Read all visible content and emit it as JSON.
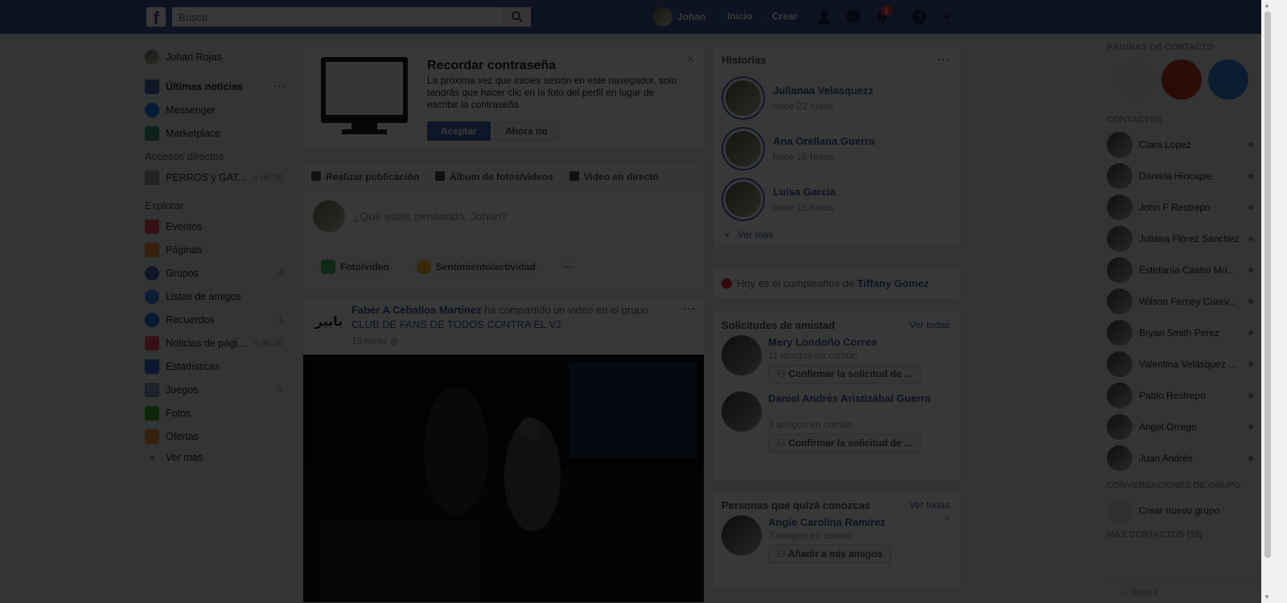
{
  "topbar": {
    "logo": "f",
    "search_placeholder": "Busca",
    "user_name": "Johan",
    "links": [
      "Inicio",
      "Crear"
    ],
    "notifications_count": "1",
    "icons": [
      "friend-requests-icon",
      "messenger-icon",
      "notifications-icon",
      "help-icon",
      "account-menu-icon"
    ]
  },
  "left_nav": {
    "profile": "Johan Rojas",
    "main": [
      {
        "label": "Últimas noticias",
        "icon": "news-feed-icon",
        "color": "#4267b2"
      },
      {
        "label": "Messenger",
        "icon": "messenger-icon",
        "color": "#0084ff"
      },
      {
        "label": "Marketplace",
        "icon": "marketplace-icon",
        "color": "#3aa17e"
      }
    ],
    "shortcuts_heading": "Accesos directos",
    "shortcuts": [
      {
        "label": "PERROS y GAT...",
        "count": "+ de 20"
      }
    ],
    "explore_heading": "Explorar",
    "explore": [
      {
        "label": "Eventos",
        "count": "",
        "icon": "events-icon",
        "color": "#f35369"
      },
      {
        "label": "Páginas",
        "count": "",
        "icon": "pages-icon",
        "color": "#f7923b"
      },
      {
        "label": "Grupos",
        "count": "4",
        "icon": "groups-icon",
        "color": "#4267b2"
      },
      {
        "label": "Listas de amigos",
        "count": "",
        "icon": "friend-lists-icon",
        "color": "#4080ff"
      },
      {
        "label": "Recuerdos",
        "count": "1",
        "icon": "memories-icon",
        "color": "#1877f2"
      },
      {
        "label": "Noticias de pági...",
        "count": "+ de 20",
        "icon": "pages-feed-icon",
        "color": "#f35369"
      },
      {
        "label": "Estadísticas",
        "count": "",
        "icon": "insights-icon",
        "color": "#3578e5"
      },
      {
        "label": "Juegos",
        "count": "4",
        "icon": "games-icon",
        "color": "#8b9dc3"
      },
      {
        "label": "Fotos",
        "count": "",
        "icon": "photos-icon",
        "color": "#42b72a"
      },
      {
        "label": "Ofertas",
        "count": "",
        "icon": "offers-icon",
        "color": "#f7923b"
      }
    ],
    "see_more": "Ver más"
  },
  "password_prompt": {
    "title": "Recordar contraseña",
    "body": "La próxima vez que inicies sesión en este navegador, solo tendrás que hacer clic en la foto del perfil en lugar de escribir la contraseña.",
    "accept": "Aceptar",
    "decline": "Ahora no"
  },
  "composer": {
    "tabs": [
      "Realizar publicación",
      "Álbum de fotos/videos",
      "Video en directo"
    ],
    "placeholder": "¿Qué estás pensando, Johan?",
    "actions": [
      "Foto/video",
      "Sentimiento/actividad"
    ],
    "more": "···"
  },
  "post": {
    "author": "Faber A Ceballos Martinez",
    "action": " ha compartido un video en el grupo ",
    "group": "CLUB DE FANS DE TODOS CONTRA EL VJ.",
    "time": "15 horas",
    "avatar_text": "بايير"
  },
  "stories": {
    "title": "Historias",
    "items": [
      {
        "name": "Julianaa Velasquezz",
        "time": "hace 22 horas"
      },
      {
        "name": "Ana Orellana Guerra",
        "time": "hace 16 horas"
      },
      {
        "name": "Luisa Garcia",
        "time": "hace 15 horas"
      }
    ],
    "see_more": "Ver más"
  },
  "birthday": {
    "prefix": "Hoy es el cumpleaños de ",
    "name": "Tiffany Gómez"
  },
  "friend_requests": {
    "title": "Solicitudes de amistad",
    "see_all": "Ver todas",
    "items": [
      {
        "name": "Mery Londoño Correa",
        "mutual": "11 amigos en común",
        "button": "Confirmar la solicitud de ..."
      },
      {
        "name": "Daniel Andrés Aristizábal Guerra",
        "mutual": "3 amigos en común",
        "button": "Confirmar la solicitud de ..."
      }
    ]
  },
  "people_you_may_know": {
    "title": "Personas que quizá conozcas",
    "see_all": "Ver todas",
    "items": [
      {
        "name": "Angie Carolina Ramírez",
        "mutual": "7 amigos en común",
        "button": "Añadir a mis amigos"
      }
    ]
  },
  "chat": {
    "pages_heading": "PÁGINAS DE CONTACTO",
    "contacts_heading": "CONTACTOS",
    "contacts": [
      "Clara Lopez",
      "Daniela Hincapie",
      "John F Restrepo",
      "Juliana Flórez Sanchez",
      "Estefanía Castro Mo...",
      "Wilson Ferney Cuerv...",
      "Bryan Smith Perez",
      "Valentina Velásquez ...",
      "Pablo Restrepo",
      "Angel Orrego",
      "Juan Andrés"
    ],
    "group_heading": "CONVERSACIONES DE GRUPO",
    "create_group": "Crear nuevo grupo",
    "more_contacts": "MÁS CONTACTOS (18)",
    "search_placeholder": "Busca"
  }
}
